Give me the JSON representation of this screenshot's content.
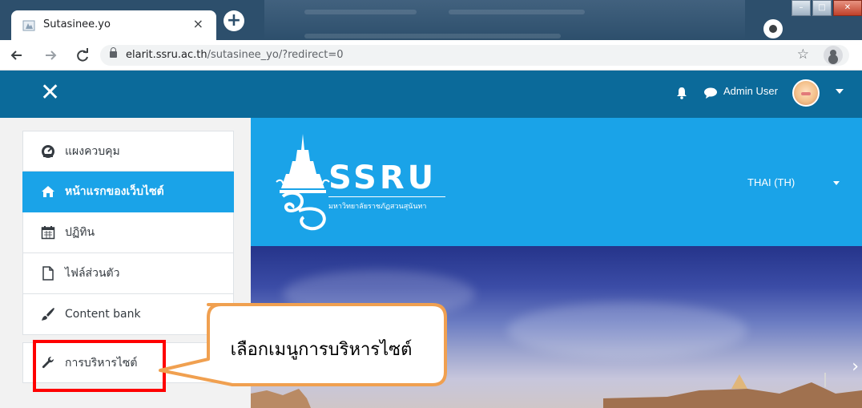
{
  "browser": {
    "tab_title": "Sutasinee.yo",
    "tab_close": "×",
    "new_tab": "+",
    "url_host": "elarit.ssru.ac.th",
    "url_path": "/sutasinee_yo/?redirect=0"
  },
  "navbar": {
    "close_symbol": "✕",
    "user_name": "Admin User"
  },
  "sidebar": {
    "items": [
      {
        "label": "แผงควบคุม",
        "icon": "dashboard-icon",
        "active": false
      },
      {
        "label": "หน้าแรกของเว็บไซต์",
        "icon": "home-icon",
        "active": true
      },
      {
        "label": "ปฏิทิน",
        "icon": "calendar-icon",
        "active": false
      },
      {
        "label": "ไฟล์ส่วนตัว",
        "icon": "file-icon",
        "active": false
      },
      {
        "label": "Content bank",
        "icon": "brush-icon",
        "active": false
      },
      {
        "label": "การบริหารไซต์",
        "icon": "wrench-icon",
        "active": false
      }
    ]
  },
  "hero": {
    "logo_text": "SSRU",
    "logo_subtitle": "มหาวิทยาลัยราชภัฏสวนสุนันทา",
    "language": "THAI (TH)"
  },
  "banner": {
    "next_symbol": "›"
  },
  "callout": {
    "text": "เลือกเมนูการบริหารไซต์"
  },
  "colors": {
    "navbar": "#0b6a9a",
    "primary": "#1aa3e8",
    "highlight": "#ff0000",
    "callout_border": "#f0a050"
  }
}
